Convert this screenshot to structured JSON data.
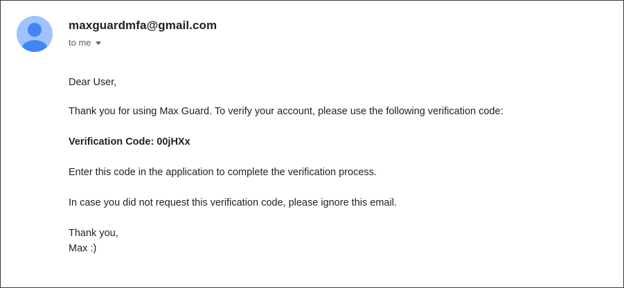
{
  "email": {
    "sender": "maxguardmfa@gmail.com",
    "recipient_label": "to me",
    "greeting": "Dear User,",
    "paragraph_1": "Thank you for using Max Guard. To verify your account, please use the following verification code:",
    "code_line": "Verification Code: 00jHXx",
    "paragraph_2": "Enter this code in the application to complete the verification process.",
    "paragraph_3": "In case you did not request this verification code, please ignore this email.",
    "closing_1": "Thank you,",
    "closing_2": "Max :)"
  },
  "colors": {
    "avatar_bg": "#a0c3ff",
    "avatar_fg": "#4285f4"
  },
  "icons": {
    "avatar": "person-avatar-icon",
    "recipient_dropdown": "caret-down-icon"
  }
}
